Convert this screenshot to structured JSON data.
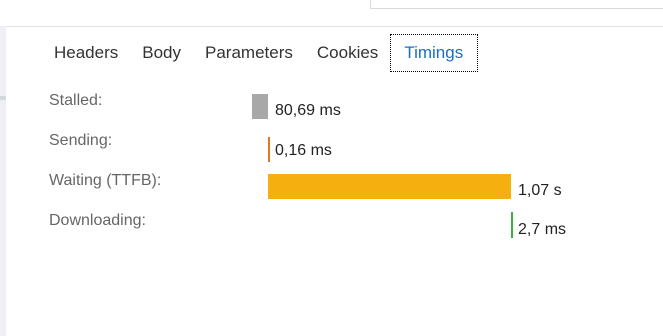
{
  "tabs": [
    {
      "label": "Headers"
    },
    {
      "label": "Body"
    },
    {
      "label": "Parameters"
    },
    {
      "label": "Cookies"
    },
    {
      "label": "Timings"
    }
  ],
  "active_tab": "Timings",
  "timings": [
    {
      "label": "Stalled:",
      "value": "80,69 ms",
      "color": "#a8a8a8"
    },
    {
      "label": "Sending:",
      "value": "0,16 ms",
      "color": "#e0781e"
    },
    {
      "label": "Waiting (TTFB):",
      "value": "1,07 s",
      "color": "#f5b010"
    },
    {
      "label": "Downloading:",
      "value": "2,7 ms",
      "color": "#3cb043"
    }
  ],
  "colors": {
    "active_tab_text": "#1a6fc4",
    "label_text": "#666666"
  }
}
